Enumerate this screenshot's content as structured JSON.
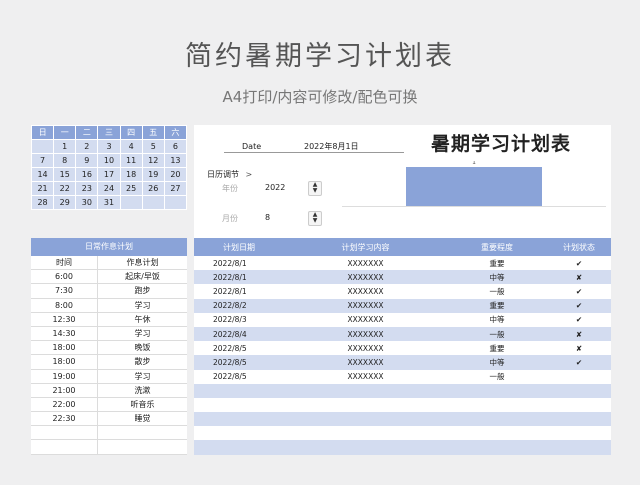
{
  "page": {
    "title": "简约暑期学习计划表",
    "subtitle": "A4打印/内容可修改/配色可换"
  },
  "calendar": {
    "weekdays": [
      "日",
      "一",
      "二",
      "三",
      "四",
      "五",
      "六"
    ],
    "weeks": [
      [
        "",
        "1",
        "2",
        "3",
        "4",
        "5",
        "6"
      ],
      [
        "7",
        "8",
        "9",
        "10",
        "11",
        "12",
        "13"
      ],
      [
        "14",
        "15",
        "16",
        "17",
        "18",
        "19",
        "20"
      ],
      [
        "21",
        "22",
        "23",
        "24",
        "25",
        "26",
        "27"
      ],
      [
        "28",
        "29",
        "30",
        "31",
        "",
        "",
        ""
      ]
    ]
  },
  "schedule": {
    "title": "日常作息计划",
    "col_time": "时间",
    "col_plan": "作息计划",
    "rows": [
      {
        "time": "6:00",
        "plan": "起床/早饭"
      },
      {
        "time": "7:30",
        "plan": "跑步"
      },
      {
        "time": "8:00",
        "plan": "学习"
      },
      {
        "time": "12:30",
        "plan": "午休"
      },
      {
        "time": "14:30",
        "plan": "学习"
      },
      {
        "time": "18:00",
        "plan": "晚饭"
      },
      {
        "time": "18:00",
        "plan": "散步"
      },
      {
        "time": "19:00",
        "plan": "学习"
      },
      {
        "time": "21:00",
        "plan": "洗漱"
      },
      {
        "time": "22:00",
        "plan": "听音乐"
      },
      {
        "time": "22:30",
        "plan": "睡觉"
      },
      {
        "time": "",
        "plan": ""
      },
      {
        "time": "",
        "plan": ""
      }
    ]
  },
  "header": {
    "date_label": "Date",
    "date_value": "2022年8月1日",
    "plan_title": "暑期学习计划表"
  },
  "adjust": {
    "title": "日历调节",
    "chevron": ">",
    "year_label": "年份",
    "year_value": "2022",
    "month_label": "月份",
    "month_value": "8",
    "step_up": "▲",
    "step_down": "▼"
  },
  "chart_data": {
    "type": "bar",
    "categories": [
      ""
    ],
    "values": [
      1
    ],
    "data_labels": [
      "1"
    ],
    "ylim": [
      0,
      1.15
    ],
    "grid": false,
    "bar_color": "#8aa3d8"
  },
  "plan_table": {
    "headers": [
      "计划日期",
      "计划学习内容",
      "重要程度",
      "计划状态"
    ],
    "rows": [
      {
        "date": "2022/8/1",
        "content": "XXXXXXX",
        "importance": "重要",
        "status": "✔"
      },
      {
        "date": "2022/8/1",
        "content": "XXXXXXX",
        "importance": "中等",
        "status": "✘"
      },
      {
        "date": "2022/8/1",
        "content": "XXXXXXX",
        "importance": "一般",
        "status": "✔"
      },
      {
        "date": "2022/8/2",
        "content": "XXXXXXX",
        "importance": "重要",
        "status": "✔"
      },
      {
        "date": "2022/8/3",
        "content": "XXXXXXX",
        "importance": "中等",
        "status": "✔"
      },
      {
        "date": "2022/8/4",
        "content": "XXXXXXX",
        "importance": "一般",
        "status": "✘"
      },
      {
        "date": "2022/8/5",
        "content": "XXXXXXX",
        "importance": "重要",
        "status": "✘"
      },
      {
        "date": "2022/8/5",
        "content": "XXXXXXX",
        "importance": "中等",
        "status": "✔"
      },
      {
        "date": "2022/8/5",
        "content": "XXXXXXX",
        "importance": "一般",
        "status": ""
      },
      {
        "date": "",
        "content": "",
        "importance": "",
        "status": ""
      },
      {
        "date": "",
        "content": "",
        "importance": "",
        "status": ""
      },
      {
        "date": "",
        "content": "",
        "importance": "",
        "status": ""
      },
      {
        "date": "",
        "content": "",
        "importance": "",
        "status": ""
      },
      {
        "date": "",
        "content": "",
        "importance": "",
        "status": ""
      }
    ]
  },
  "colors": {
    "accent": "#8aa3d8",
    "band": "#d3dcf0"
  }
}
